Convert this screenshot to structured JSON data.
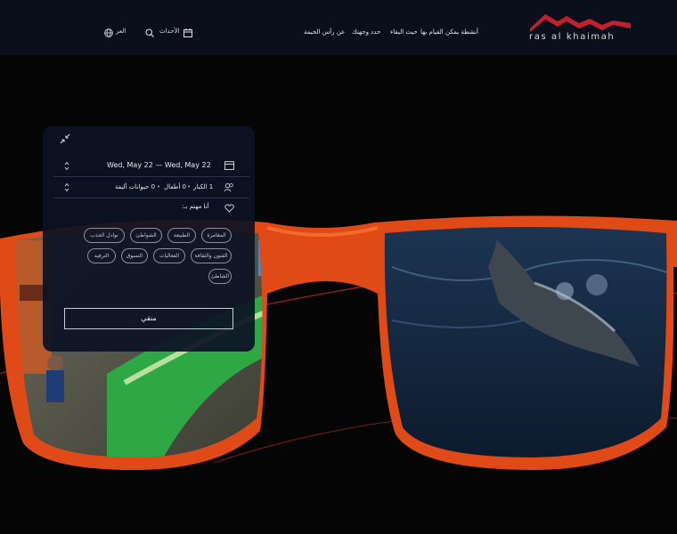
{
  "header": {
    "logo_text": "ras al khaimah",
    "nav": [
      "أنشطة يمكن القيام بها",
      "حيث البقاء",
      "حدد وجهتك",
      "عن رأس الخيمة"
    ],
    "events_label": "الأحداث",
    "language_label": "العر",
    "icons": [
      "rak-logo-icon",
      "calendar-icon",
      "search-icon",
      "globe-icon"
    ]
  },
  "planner": {
    "date_range": "Wed, May 22 — Wed, May 22",
    "guests_adults": "1 الكبار",
    "guests_children": "0 أطفال",
    "guests_pets": "0 حيوانات أليفة",
    "interest_label": "أنا مهتم بـ:",
    "chips": [
      "المغامرة",
      "الطبيعة",
      "الشواطئ",
      "نوادل الجذب",
      "الفنون والثقافة",
      "الفعاليات",
      "التسوق",
      "الترفيه",
      "الشاطئ"
    ],
    "apply_label": "منقي",
    "icons": [
      "collapse-icon",
      "calendar-icon",
      "users-icon",
      "heart-icon",
      "chevron-updown-icon"
    ]
  },
  "colors": {
    "header_bg": "#0b0f1b",
    "page_bg": "#050506",
    "panel_bg": "#0c1224",
    "frame_orange": "#e04a17",
    "logo_red": "#c0212d",
    "accent_line": "#b5242d"
  }
}
